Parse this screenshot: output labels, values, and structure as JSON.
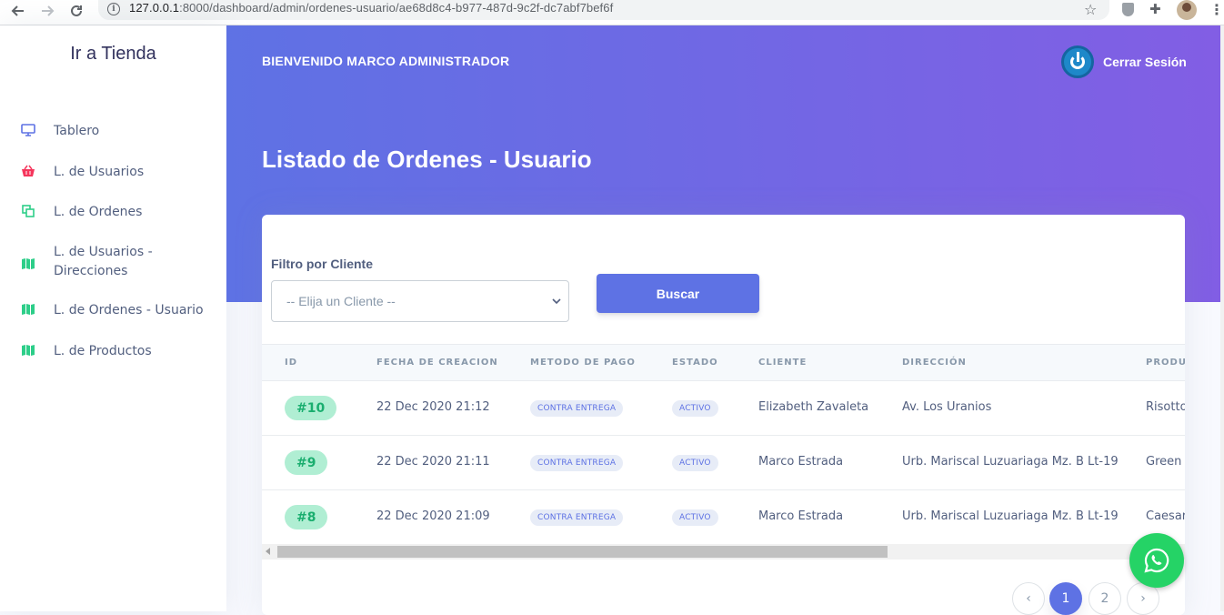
{
  "browser": {
    "url_host": "127.0.0.1",
    "url_path": ":8000/dashboard/admin/ordenes-usuario/ae68d8c4-b977-487d-9c2f-dc7abf7bef6f"
  },
  "sidebar": {
    "brand": "Ir a Tienda",
    "items": [
      {
        "label": "Tablero",
        "icon": "monitor-icon",
        "color": "#5e72e4"
      },
      {
        "label": "L. de Usuarios",
        "icon": "basket-icon",
        "color": "#f5365c"
      },
      {
        "label": "L. de Ordenes",
        "icon": "copy-icon",
        "color": "#2dce89"
      },
      {
        "label": "L. de Usuarios - Direcciones",
        "icon": "map-icon",
        "color": "#2dce89"
      },
      {
        "label": "L. de Ordenes - Usuario",
        "icon": "map-icon",
        "color": "#2dce89"
      },
      {
        "label": "L. de Productos",
        "icon": "map-icon",
        "color": "#2dce89"
      }
    ]
  },
  "header": {
    "welcome": "BIENVENIDO MARCO ADMINISTRADOR",
    "logout_label": "Cerrar Sesión",
    "page_title": "Listado de Ordenes - Usuario"
  },
  "filter": {
    "label": "Filtro por Cliente",
    "select_value": "-- Elija un Cliente --",
    "button_label": "Buscar"
  },
  "table": {
    "headers": [
      "ID",
      "FECHA DE CREACION",
      "METODO DE PAGO",
      "ESTADO",
      "CLIENTE",
      "DIRECCIÓN",
      "PRODU"
    ],
    "rows": [
      {
        "id": "#10",
        "fecha": "22 Dec 2020 21:12",
        "metodo": "CONTRA ENTREGA",
        "estado": "ACTIVO",
        "cliente": "Elizabeth Zavaleta",
        "direccion": "Av. Los Uranios",
        "producto": "Risotto"
      },
      {
        "id": "#9",
        "fecha": "22 Dec 2020 21:11",
        "metodo": "CONTRA ENTREGA",
        "estado": "ACTIVO",
        "cliente": "Marco Estrada",
        "direccion": "Urb. Mariscal Luzuariaga Mz. B Lt-19",
        "producto": "Green s"
      },
      {
        "id": "#8",
        "fecha": "22 Dec 2020 21:09",
        "metodo": "CONTRA ENTREGA",
        "estado": "ACTIVO",
        "cliente": "Marco Estrada",
        "direccion": "Urb. Mariscal Luzuariaga Mz. B Lt-19",
        "producto": "Caesar"
      }
    ]
  },
  "pagination": {
    "prev": "‹",
    "pages": [
      "1",
      "2"
    ],
    "next": "›",
    "active": "1"
  },
  "colors": {
    "primary": "#5e72e4",
    "gradient_end": "#825ee4",
    "success": "#2dce89",
    "whatsapp": "#25d366"
  }
}
